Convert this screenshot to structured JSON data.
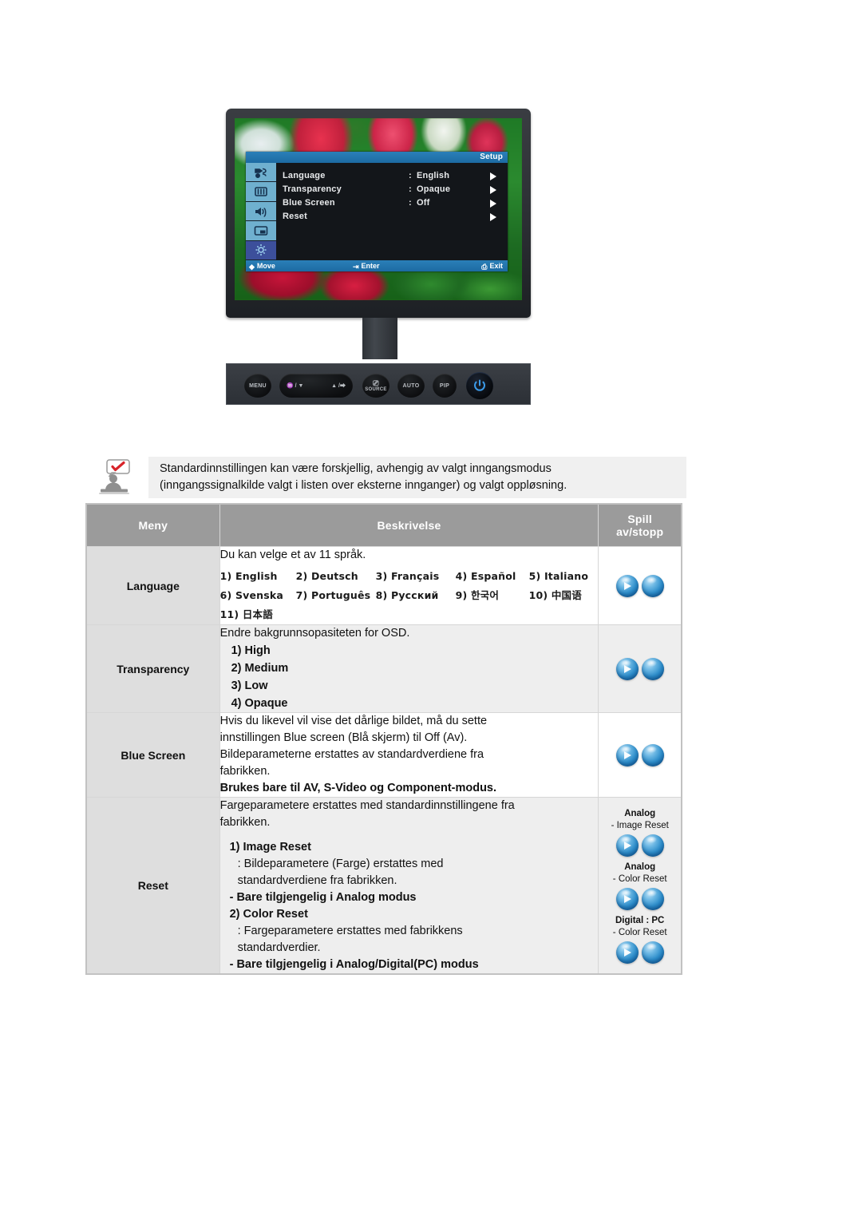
{
  "monitor": {
    "osd": {
      "title": "Setup",
      "rows": [
        {
          "name": "Language",
          "colon": ":",
          "value": "English"
        },
        {
          "name": "Transparency",
          "colon": ":",
          "value": "Opaque"
        },
        {
          "name": "Blue Screen",
          "colon": ":",
          "value": "Off"
        },
        {
          "name": "Reset",
          "colon": "",
          "value": ""
        }
      ],
      "footer": {
        "move": "Move",
        "enter": "Enter",
        "exit": "Exit"
      },
      "sidebar_icons": [
        "input-source-icon",
        "picture-icon",
        "sound-icon",
        "pip-icon",
        "setup-gear-icon"
      ],
      "selected_icon_index": 4,
      "title_bar_color": "#1d6ba3",
      "body_color": "#13161a"
    },
    "buttons": {
      "menu": "MENU",
      "nav_left": "♒ / ▼",
      "nav_right": "▲ /⮕",
      "source": "SOURCE",
      "auto": "AUTO",
      "pip": "PIP",
      "power": "power-icon"
    }
  },
  "note": {
    "icon": "note-person-check-icon",
    "lines": [
      "Standardinnstillingen kan være forskjellig, avhengig av valgt inngangsmodus",
      "(inngangssignalkilde valgt i listen over eksterne innganger) og valgt oppløsning."
    ]
  },
  "table": {
    "headers": {
      "meny": "Meny",
      "beskrivelse": "Beskrivelse",
      "spill_line1": "Spill",
      "spill_line2": "av/stopp"
    },
    "rows": [
      {
        "menu": "Language",
        "intro": "Du kan velge et av 11 språk.",
        "languages": [
          [
            "1) English",
            "2) Deutsch",
            "3) Français",
            "4) Español",
            "5) Italiano"
          ],
          [
            "6) Svenska",
            "7) Português",
            "8) Русский",
            "9) 한국어",
            "10) 中国语"
          ],
          [
            "11) 日本語",
            "",
            "",
            "",
            ""
          ]
        ]
      },
      {
        "menu": "Transparency",
        "intro": "Endre bakgrunnsopasiteten for OSD.",
        "options": [
          "1) High",
          "2) Medium",
          "3) Low",
          "4) Opaque"
        ]
      },
      {
        "menu": "Blue Screen",
        "paragraph": [
          "Hvis du likevel vil vise det dårlige bildet, må du sette",
          "innstillingen Blue screen (Blå skjerm) til Off (Av).",
          "Bildeparameterne erstattes av standardverdiene fra",
          "fabrikken."
        ],
        "bold_note": "Brukes bare til AV, S-Video og Component-modus."
      },
      {
        "menu": "Reset",
        "paragraph": [
          "Fargeparametere erstattes med standardinnstillingene fra",
          "fabrikken."
        ],
        "items": [
          {
            "head": "1) Image Reset",
            "desc": [
              ": Bildeparametere (Farge) erstattes med",
              "standardverdiene fra fabrikken."
            ],
            "bold": "- Bare tilgjengelig i Analog modus"
          },
          {
            "head": "2) Color Reset",
            "desc": [
              ": Fargeparametere erstattes med fabrikkens",
              "standardverdier."
            ],
            "bold": "- Bare tilgjengelig i Analog/Digital(PC) modus"
          }
        ],
        "spill_groups": [
          {
            "line1": "Analog",
            "line2": "- Image Reset"
          },
          {
            "line1": "Analog",
            "line2": "- Color Reset"
          },
          {
            "line1": "Digital : PC",
            "line2": "- Color Reset"
          }
        ]
      }
    ]
  },
  "colors": {
    "header_gray": "#9b9b9b",
    "menu_cell_gray": "#dedede",
    "alt_row_gray": "#eeeeee",
    "note_bg": "#f0f0f0",
    "sphere_blue": "#2e8ecb",
    "osd_blue": "#1d6ba3"
  }
}
